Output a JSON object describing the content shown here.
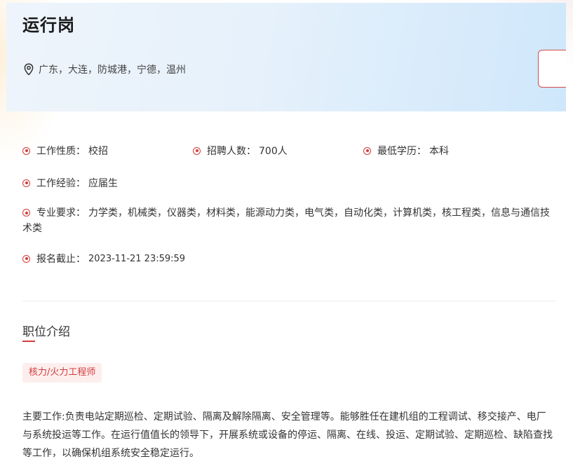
{
  "job": {
    "title": "运行岗",
    "location": "广东，大连，防城港，宁德，温州"
  },
  "details": {
    "nature_label": "工作性质：",
    "nature_value": "校招",
    "headcount_label": "招聘人数：",
    "headcount_value": "700人",
    "education_label": "最低学历：",
    "education_value": "本科",
    "experience_label": "工作经验：",
    "experience_value": "应届生",
    "major_label": "专业要求：",
    "major_value": "力学类，机械类，仪器类，材料类，能源动力类，电气类，自动化类，计算机类，核工程类，信息与通信技术类",
    "deadline_label": "报名截止：",
    "deadline_value": "2023-11-21 23:59:59"
  },
  "intro": {
    "section_title": "职位介绍",
    "tag": "核力/火力工程师",
    "description": "主要工作:负责电站定期巡检、定期试验、隔离及解除隔离、安全管理等。能够胜任在建机组的工程调试、移交接产、电厂与系统投运等工作。在运行值值长的领导下，开展系统或设备的停运、隔离、在线、投运、定期试验、定期巡检、缺陷查找等工作，以确保机组系统安全稳定运行。"
  },
  "colors": {
    "accent": "#d33c3c",
    "hero_start": "#eef4fb",
    "hero_end": "#cfe7fb",
    "tag_bg": "#fdeeee"
  },
  "icons": {
    "location": "location-pin-icon",
    "bullet": "red-dot-bullet-icon"
  }
}
